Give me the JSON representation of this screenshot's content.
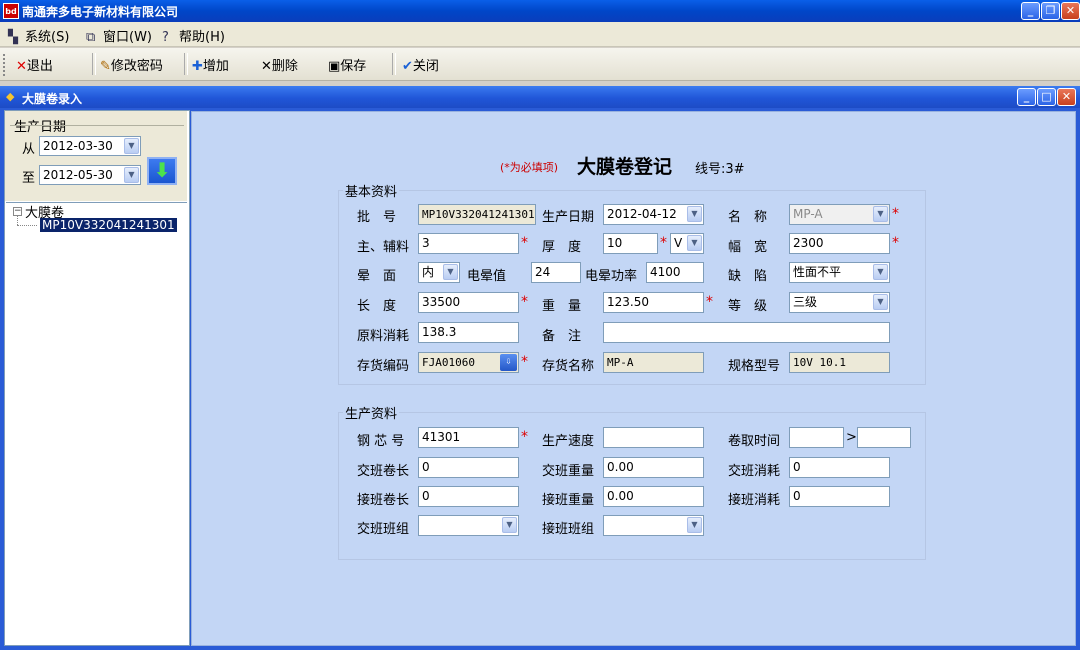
{
  "app": {
    "title": "南通奔多电子新材料有限公司",
    "icon_text": "bd"
  },
  "menu": {
    "items": [
      "系统(S)",
      "窗口(W)",
      "帮助(H)"
    ]
  },
  "toolbar": {
    "exit": "退出",
    "change_pwd": "修改密码",
    "add": "增加",
    "delete": "删除",
    "save": "保存",
    "close": "关闭"
  },
  "child": {
    "title": "大膜卷录入"
  },
  "left": {
    "group": "生产日期",
    "from_label": "从",
    "from_date": "2012-03-30",
    "to_label": "至",
    "to_date": "2012-05-30",
    "tree_root": "大膜卷",
    "tree_child": "MP10V332041241301"
  },
  "form": {
    "required_note": "(*为必填项)",
    "title": "大膜卷登记",
    "line_no": "线号:3#",
    "basic": {
      "legend": "基本资料",
      "batch_label": "批　号",
      "batch_value": "MP10V332041241301",
      "prod_date_label": "生产日期",
      "prod_date_value": "2012-04-12",
      "name_label": "名　称",
      "name_value": "MP-A",
      "material_label": "主、辅料",
      "material_value": "3",
      "thickness_label": "厚　度",
      "thickness_value": "10",
      "thickness_unit": "V",
      "width_label": "幅　宽",
      "width_value": "2300",
      "halo_face_label": "晕　面",
      "halo_face_value": "内",
      "halo_value_label": "电晕值",
      "halo_value_value": "24",
      "halo_power_label": "电晕功率",
      "halo_power_value": "4100",
      "defect_label": "缺　陷",
      "defect_value": "性面不平",
      "length_label": "长　度",
      "length_value": "33500",
      "weight_label": "重　量",
      "weight_value": "123.50",
      "grade_label": "等　级",
      "grade_value": "三级",
      "consume_label": "原料消耗",
      "consume_value": "138.3",
      "remark_label": "备　注",
      "remark_value": "",
      "stock_code_label": "存货编码",
      "stock_code_value": "FJA01060",
      "stock_name_label": "存货名称",
      "stock_name_value": "MP-A",
      "spec_label": "规格型号",
      "spec_value": "10V 10.1"
    },
    "production": {
      "legend": "生产资料",
      "core_label": "钢 芯 号",
      "core_value": "41301",
      "speed_label": "生产速度",
      "speed_value": "",
      "time_label": "卷取时间",
      "time_from": "",
      "time_sep": ">",
      "time_to": "",
      "shift_len_label": "交班卷长",
      "shift_len_value": "0",
      "shift_weight_label": "交班重量",
      "shift_weight_value": "0.00",
      "shift_consume_label": "交班消耗",
      "shift_consume_value": "0",
      "take_len_label": "接班卷长",
      "take_len_value": "0",
      "take_weight_label": "接班重量",
      "take_weight_value": "0.00",
      "take_consume_label": "接班消耗",
      "take_consume_value": "0",
      "shift_team_label": "交班班组",
      "shift_team_value": "",
      "take_team_label": "接班班组",
      "take_team_value": ""
    }
  }
}
